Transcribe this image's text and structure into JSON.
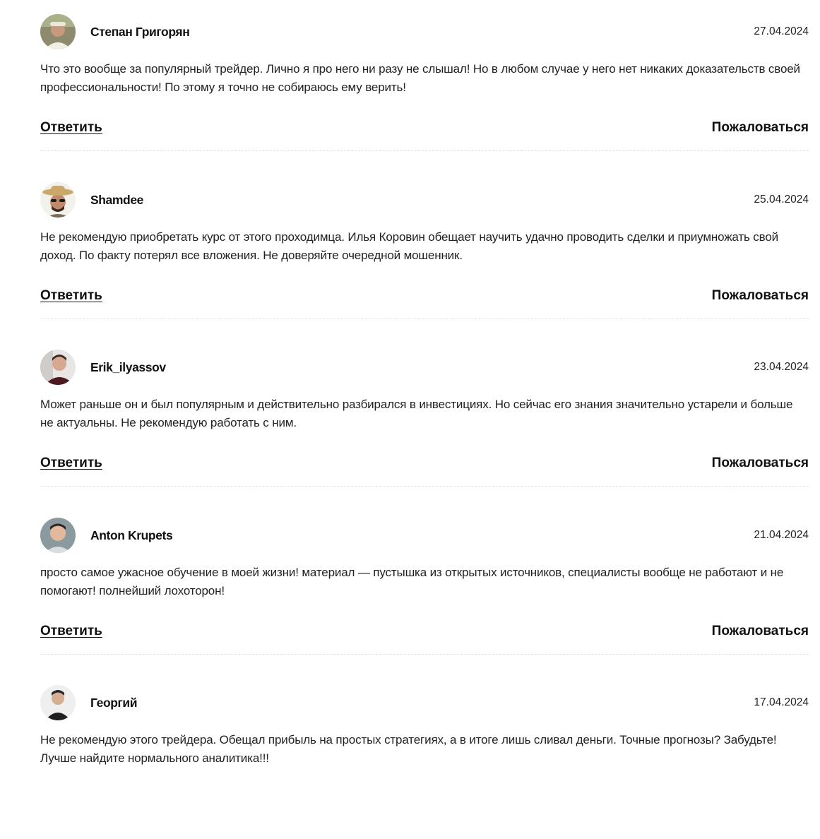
{
  "actions": {
    "reply_label": "Ответить",
    "report_label": "Пожаловаться"
  },
  "comments": [
    {
      "author": "Степан Григорян",
      "date": "27.04.2024",
      "text": "Что это вообще за популярный трейдер. Лично я про него ни разу не слышал! Но в любом случае у него нет никаких доказательств своей профессиональности! По этому я точно не собираюсь ему верить!",
      "avatar_icon": "user-avatar-icon"
    },
    {
      "author": "Shamdee",
      "date": "25.04.2024",
      "text": "Не рекомендую приобретать курс от этого проходимца. Илья Коровин обещает научить удачно проводить сделки и приумножать свой доход. По факту потерял все вложения. Не доверяйте очередной мошенник.",
      "avatar_icon": "user-avatar-icon"
    },
    {
      "author": "Erik_ilyassov",
      "date": "23.04.2024",
      "text": "Может раньше он и был популярным и действительно разбирался в инвестициях. Но сейчас его знания значительно устарели и больше не актуальны. Не рекомендую работать с ним.",
      "avatar_icon": "user-avatar-icon"
    },
    {
      "author": "Anton Krupets",
      "date": "21.04.2024",
      "text": "просто самое ужасное обучение в моей жизни! материал — пустышка из открытых источников, специалисты вообще не работают и не помогают! полнейший лохоторон!",
      "avatar_icon": "user-avatar-icon"
    },
    {
      "author": "Георгий",
      "date": "17.04.2024",
      "text": "Не рекомендую этого трейдера. Обещал прибыль на простых стратегиях, а в итоге лишь сливал деньги. Точные прогнозы? Забудьте! Лучше найдите нормального аналитика!!!",
      "avatar_icon": "user-avatar-icon"
    }
  ]
}
